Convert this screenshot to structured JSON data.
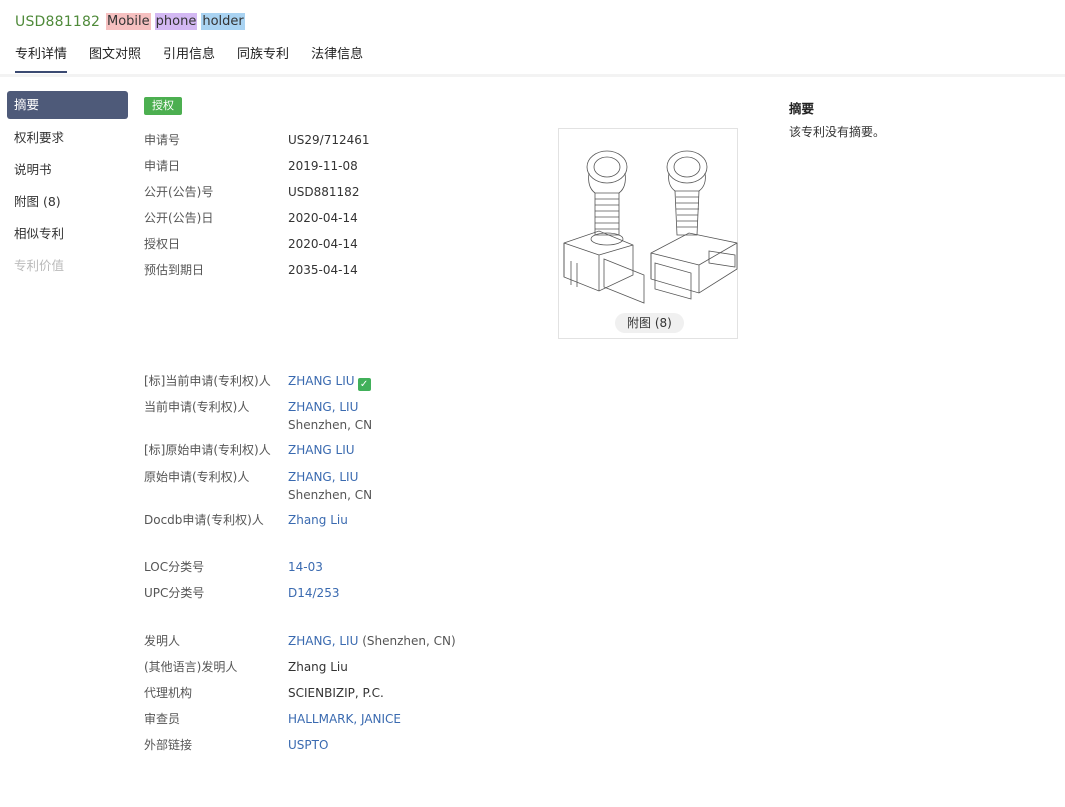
{
  "header": {
    "patent_number": "USD881182",
    "title_words": [
      {
        "text": "Mobile",
        "color": "#f6c0c0"
      },
      {
        "text": "phone",
        "color": "#d3b8f3"
      },
      {
        "text": "holder",
        "color": "#a9d3f2"
      }
    ],
    "tabs": [
      "专利详情",
      "图文对照",
      "引用信息",
      "同族专利",
      "法律信息"
    ],
    "active_tab": "专利详情"
  },
  "sidebar": {
    "items": [
      {
        "label": "摘要",
        "state": "active"
      },
      {
        "label": "权利要求",
        "state": "normal"
      },
      {
        "label": "说明书",
        "state": "normal"
      },
      {
        "label": "附图 (8)",
        "state": "normal"
      },
      {
        "label": "相似专利",
        "state": "normal"
      },
      {
        "label": "专利价值",
        "state": "disabled"
      }
    ]
  },
  "status_badge": "授权",
  "basic_info": {
    "application_number": {
      "label": "申请号",
      "value": "US29/712461"
    },
    "application_date": {
      "label": "申请日",
      "value": "2019-11-08"
    },
    "publication_number": {
      "label": "公开(公告)号",
      "value": "USD881182"
    },
    "publication_date": {
      "label": "公开(公告)日",
      "value": "2020-04-14"
    },
    "grant_date": {
      "label": "授权日",
      "value": "2020-04-14"
    },
    "expiry_date": {
      "label": "预估到期日",
      "value": "2035-04-14"
    }
  },
  "figure": {
    "button_label": "附图 (8)"
  },
  "parties": {
    "std_current_assignee": {
      "label": "[标]当前申请(专利权)人",
      "value": "ZHANG LIU",
      "verified": true
    },
    "current_assignee": {
      "label": "当前申请(专利权)人",
      "value": "ZHANG, LIU",
      "location": "Shenzhen, CN"
    },
    "std_original_assignee": {
      "label": "[标]原始申请(专利权)人",
      "value": "ZHANG LIU"
    },
    "original_assignee": {
      "label": "原始申请(专利权)人",
      "value": "ZHANG, LIU",
      "location": "Shenzhen, CN"
    },
    "docdb_assignee": {
      "label": "Docdb申请(专利权)人",
      "value": "Zhang Liu"
    }
  },
  "classification": {
    "loc": {
      "label": "LOC分类号",
      "value": "14-03"
    },
    "upc": {
      "label": "UPC分类号",
      "value": "D14/253"
    }
  },
  "people": {
    "inventor": {
      "label": "发明人",
      "value": "ZHANG, LIU",
      "suffix": "(Shenzhen, CN)"
    },
    "inventor_other_lang": {
      "label": "(其他语言)发明人",
      "value": "Zhang Liu"
    },
    "agency": {
      "label": "代理机构",
      "value": "SCIENBIZIP, P.C."
    },
    "examiner": {
      "label": "审查员",
      "value": "HALLMARK, JANICE"
    },
    "external_link": {
      "label": "外部链接",
      "value": "USPTO"
    }
  },
  "abstract": {
    "title": "摘要",
    "text": "该专利没有摘要。"
  }
}
